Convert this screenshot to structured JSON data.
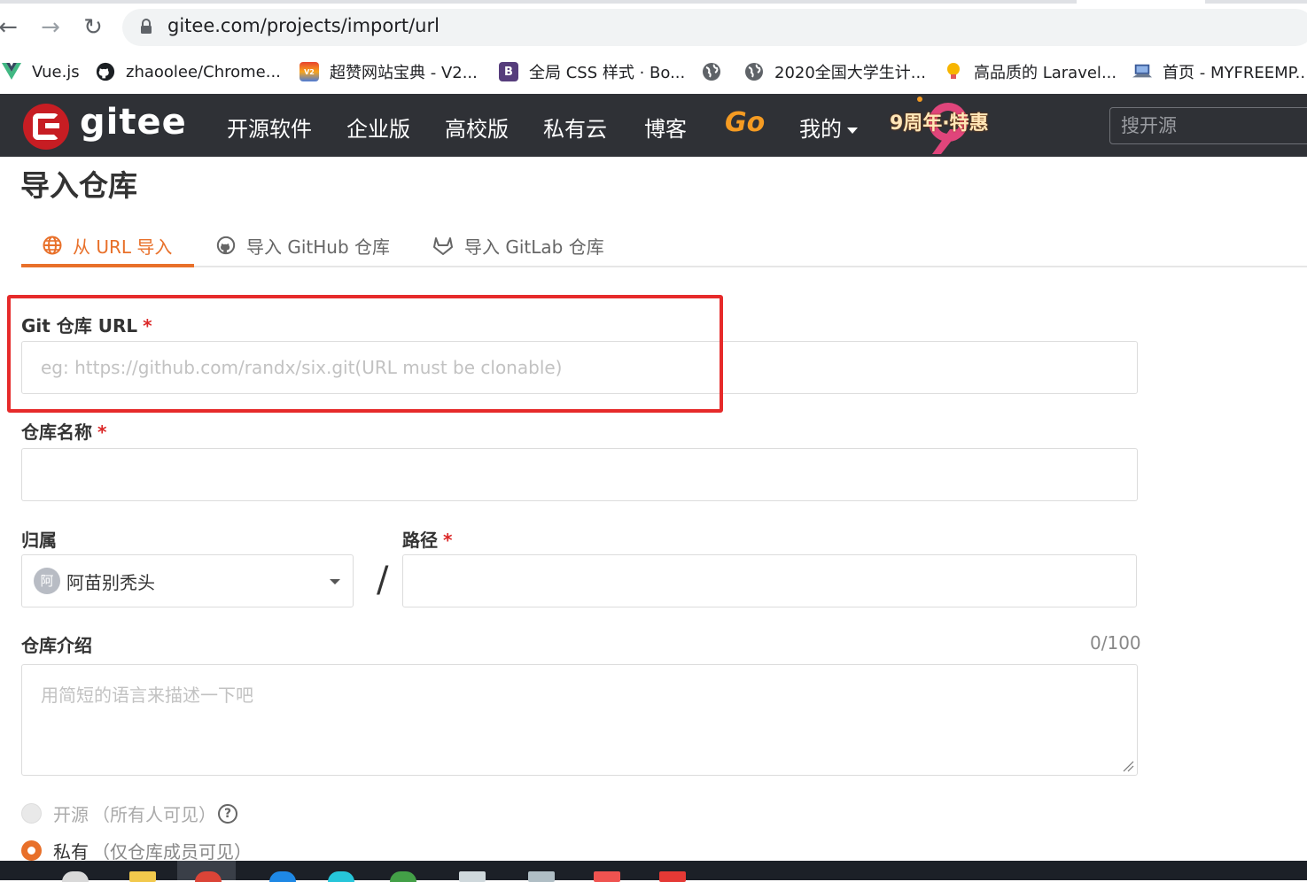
{
  "browser": {
    "url": "gitee.com/projects/import/url",
    "bookmarks": [
      {
        "label": "Vue.js",
        "icon": "vue-icon"
      },
      {
        "label": "zhaoolee/Chrome...",
        "icon": "github-icon"
      },
      {
        "label": "超赞网站宝典 - V2...",
        "icon": "v2-icon"
      },
      {
        "label": "全局 CSS 样式 · Bo...",
        "icon": "bootstrap-icon"
      },
      {
        "label": "",
        "icon": "globe-icon"
      },
      {
        "label": "2020全国大学生计...",
        "icon": "globe-icon"
      },
      {
        "label": "高品质的 Laravel...",
        "icon": "bulb-icon"
      },
      {
        "label": "首页 - MYFREEMP...",
        "icon": "computer-icon"
      }
    ]
  },
  "header": {
    "logo_text": "gitee",
    "nav": [
      "开源软件",
      "企业版",
      "高校版",
      "私有云",
      "博客",
      "Go",
      "我的"
    ],
    "anniversary": "9周年·特惠",
    "search_placeholder": "搜开源"
  },
  "page": {
    "title": "导入仓库",
    "tabs": [
      {
        "label": "从 URL 导入",
        "icon": "globe-icon",
        "active": true
      },
      {
        "label": "导入 GitHub 仓库",
        "icon": "github-icon",
        "active": false
      },
      {
        "label": "导入 GitLab 仓库",
        "icon": "gitlab-icon",
        "active": false
      }
    ]
  },
  "form": {
    "git_url_label": "Git 仓库 URL",
    "git_url_placeholder": "eg: https://github.com/randx/six.git(URL must be clonable)",
    "repo_name_label": "仓库名称",
    "owner_label": "归属",
    "owner_value": "阿苗别秃头",
    "owner_avatar": "阿",
    "path_label": "路径",
    "separator": "/",
    "intro_label": "仓库介绍",
    "intro_counter": "0/100",
    "intro_placeholder": "用简短的语言来描述一下吧",
    "required_mark": "*",
    "visibility": [
      {
        "label": "开源",
        "note": "（所有人可见）",
        "selected": false,
        "help": "?"
      },
      {
        "label": "私有",
        "note": "（仅仓库成员可见）",
        "selected": true
      }
    ]
  },
  "colors": {
    "accent": "#e8702a",
    "header_bg": "#2f3136",
    "brand_red": "#c71d23",
    "required": "#db2828",
    "highlight_box": "#e62a2a"
  }
}
